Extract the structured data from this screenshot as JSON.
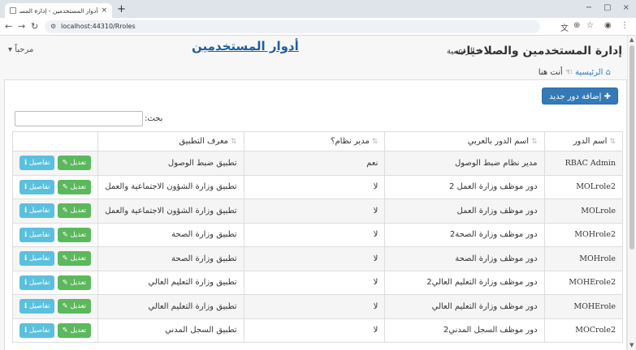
{
  "browser": {
    "tab_title": "أدوار المستخدمين - إدارة المستخ",
    "tab_close": "×",
    "new_tab": "+",
    "url": "localhost:44310/Rroles",
    "win_min": "−",
    "win_max": "▢",
    "win_close": "×"
  },
  "header": {
    "brand": "إدارة المستخدمين والصلاحيات",
    "home_label": "الرئيسية",
    "page_title": "أدوار المستخدمين",
    "welcome": "مرحباً"
  },
  "breadcrumb": {
    "home": "الرئيسية",
    "here": "أنت هنا"
  },
  "toolbar": {
    "add_label": "إضافة دور جديد",
    "search_label": "بحث:"
  },
  "table": {
    "headers": [
      "اسم الدور",
      "اسم الدور بالعربي",
      "مدير نظام؟",
      "معرف التطبيق"
    ],
    "edit_label": "تعديل",
    "details_label": "تفاصيل",
    "rows": [
      {
        "name": "RBAC Admin",
        "ar": "مدير نظام ضبط الوصول",
        "admin": "نعم",
        "app": "تطبيق ضبط الوصول"
      },
      {
        "name": "MOLrole2",
        "ar": "دور موظف وزارة العمل 2",
        "admin": "لا",
        "app": "تطبيق وزارة الشؤون الاجتماعية والعمل"
      },
      {
        "name": "MOLrole",
        "ar": "دور موظف وزارة العمل",
        "admin": "لا",
        "app": "تطبيق وزارة الشؤون الاجتماعية والعمل"
      },
      {
        "name": "MOHrole2",
        "ar": "دور موظف وزارة الصحة2",
        "admin": "لا",
        "app": "تطبيق وزارة الصحة"
      },
      {
        "name": "MOHrole",
        "ar": "دور موظف وزارة الصحة",
        "admin": "لا",
        "app": "تطبيق وزارة الصحة"
      },
      {
        "name": "MOHErole2",
        "ar": "دور موظف وزارة التعليم العالي2",
        "admin": "لا",
        "app": "تطبيق وزارة التعليم العالي"
      },
      {
        "name": "MOHErole",
        "ar": "دور موظف وزارة التعليم العالي",
        "admin": "لا",
        "app": "تطبيق وزارة التعليم العالي"
      },
      {
        "name": "MOCrole2",
        "ar": "دور موظف السجل المدني2",
        "admin": "لا",
        "app": "تطبيق السجل المدني"
      }
    ]
  }
}
